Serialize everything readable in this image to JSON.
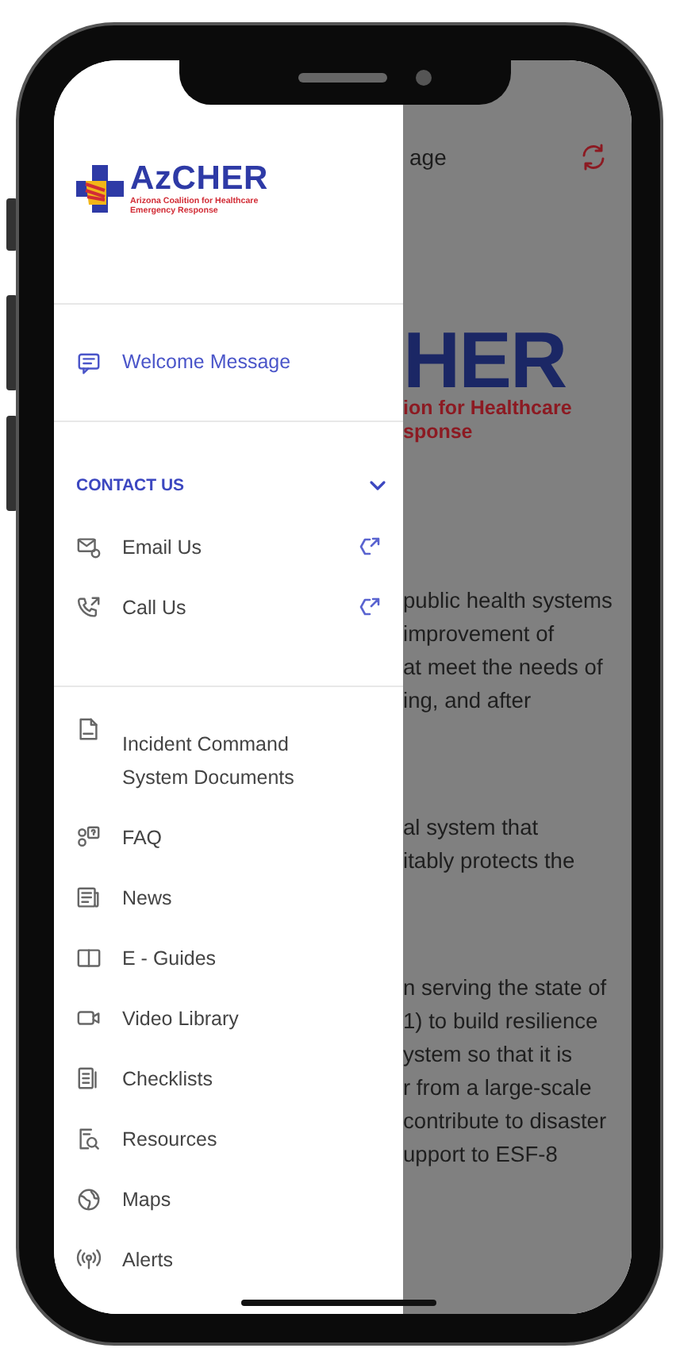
{
  "drawer": {
    "logo": {
      "name": "AzCHER",
      "tagline": [
        "Arizona Coalition for Healthcare",
        "Emergency Response"
      ]
    },
    "top_items": [
      {
        "label": "Welcome Message",
        "selected": true
      }
    ],
    "contact": {
      "title": "CONTACT US",
      "expanded": true,
      "items": [
        {
          "label": "Email Us",
          "selected": false
        },
        {
          "label": "Call Us",
          "selected": false
        }
      ]
    },
    "items": [
      {
        "label": "Incident Command System Documents",
        "selected": false
      },
      {
        "label": "FAQ",
        "selected": false
      },
      {
        "label": "News",
        "selected": false
      },
      {
        "label": "E - Guides",
        "selected": false
      },
      {
        "label": "Video Library",
        "selected": false
      },
      {
        "label": "Checklists",
        "selected": false
      },
      {
        "label": "Resources",
        "selected": false
      },
      {
        "label": "Maps",
        "selected": false
      },
      {
        "label": "Alerts",
        "selected": false
      }
    ]
  },
  "background_page": {
    "header_title": "age",
    "hero": {
      "title": "HER",
      "subtitle": [
        "ion for Healthcare",
        "sponse"
      ]
    },
    "paragraphs": [
      [
        "public health systems",
        "improvement of",
        "at meet the needs of",
        "ing, and after"
      ],
      [
        "al system that",
        "itably protects the"
      ],
      [
        "n serving the state of",
        "1) to build resilience",
        "ystem so that it is",
        "r from a large-scale",
        "contribute to disaster",
        "upport to ESF-8"
      ]
    ]
  }
}
